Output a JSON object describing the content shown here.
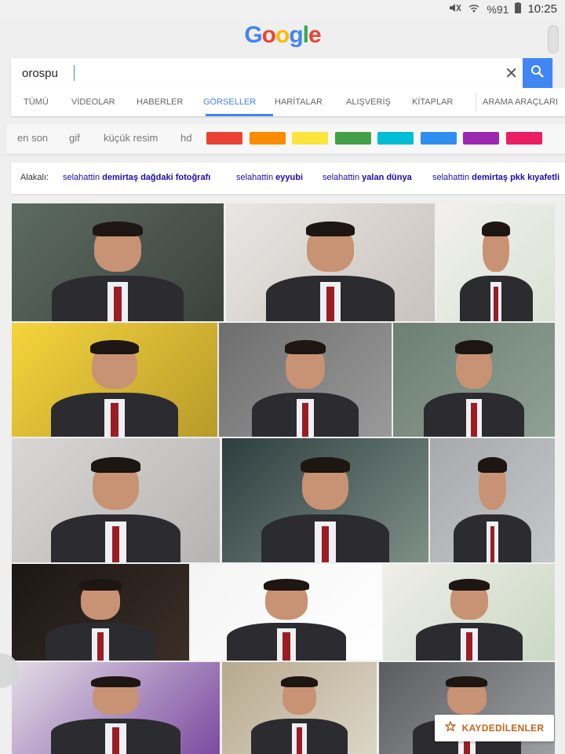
{
  "status_bar": {
    "battery": "%91",
    "time": "10:25"
  },
  "logo": {
    "letters": [
      "G",
      "o",
      "o",
      "g",
      "l",
      "e"
    ],
    "colors": [
      "#4285f4",
      "#ea4335",
      "#fbbc05",
      "#4285f4",
      "#34a853",
      "#ea4335"
    ]
  },
  "search": {
    "value": "orospu"
  },
  "tabs": [
    {
      "label": "TÜMÜ"
    },
    {
      "label": "VİDEOLAR"
    },
    {
      "label": "HABERLER"
    },
    {
      "label": "GÖRSELLER"
    },
    {
      "label": "HARİTALAR"
    },
    {
      "label": "ALIŞVERİŞ"
    },
    {
      "label": "KİTAPLAR"
    },
    {
      "label": "ARAMA ARAÇLARI"
    }
  ],
  "active_tab": "GÖRSELLER",
  "filters": [
    {
      "label": "en son"
    },
    {
      "label": "gif"
    },
    {
      "label": "küçük resim"
    },
    {
      "label": "hd"
    }
  ],
  "color_swatches": [
    "#e94234",
    "#fb8c00",
    "#fbe43c",
    "#43a047",
    "#00bcd4",
    "#2f8ff0",
    "#9c27b0",
    "#e91e63"
  ],
  "related": {
    "label": "Alakalı:",
    "items": [
      {
        "prefix": "selahattin ",
        "bold": "demirtaş dağdaki fotoğrafı"
      },
      {
        "prefix": "selahattin ",
        "bold": "eyyubi"
      },
      {
        "prefix": "selahattin ",
        "bold": "yalan dünya"
      },
      {
        "prefix": "selahattin ",
        "bold": "demirtaş pkk kıyafetli"
      }
    ]
  },
  "saved_button": {
    "label": "KAYDEDİLENLER"
  },
  "colors": {
    "accent": "#4285f4",
    "link": "#1a0dab",
    "saved": "#c5641b"
  }
}
